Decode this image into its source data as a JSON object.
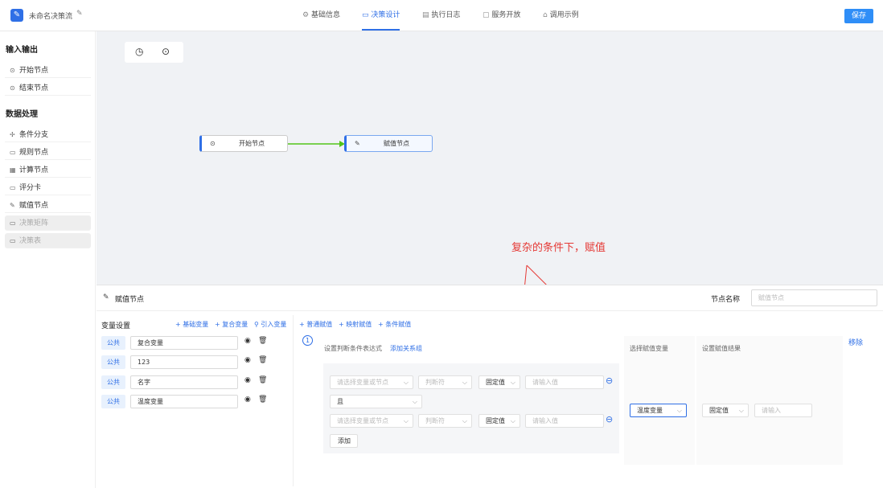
{
  "header": {
    "title": "未命名决策流",
    "tabs": [
      {
        "label": "基础信息"
      },
      {
        "label": "决策设计"
      },
      {
        "label": "执行日志"
      },
      {
        "label": "服务开放"
      },
      {
        "label": "调用示例"
      }
    ],
    "save_label": "保存"
  },
  "sidebar": {
    "sections": [
      {
        "title": "输入输出",
        "items": [
          {
            "label": "开始节点"
          },
          {
            "label": "结束节点"
          }
        ]
      },
      {
        "title": "数据处理",
        "items": [
          {
            "label": "条件分支"
          },
          {
            "label": "规则节点"
          },
          {
            "label": "计算节点"
          },
          {
            "label": "评分卡"
          },
          {
            "label": "赋值节点"
          },
          {
            "label": "决策矩阵"
          },
          {
            "label": "决策表"
          }
        ]
      }
    ]
  },
  "canvas": {
    "nodes": [
      {
        "label": "开始节点"
      },
      {
        "label": "赋值节点"
      }
    ],
    "annotation": "复杂的条件下，赋值"
  },
  "panel": {
    "title": "赋值节点",
    "node_name_label": "节点名称",
    "node_name_placeholder": "赋值节点",
    "var_settings": {
      "title": "变量设置",
      "actions": [
        "基础变量",
        "复合变量",
        "引入变量"
      ],
      "rows": [
        {
          "scope": "公共",
          "name": "复合变量"
        },
        {
          "scope": "公共",
          "name": "123"
        },
        {
          "scope": "公共",
          "name": "名字"
        },
        {
          "scope": "公共",
          "name": "温度变量"
        }
      ]
    },
    "assign": {
      "actions": [
        "普通赋值",
        "映射赋值",
        "条件赋值"
      ],
      "index": "1",
      "cond_label": "设置判断条件表达式",
      "add_group": "添加关系组",
      "var_placeholder": "请选择变量或节点",
      "op_placeholder": "判断符",
      "fixed_value": "固定值",
      "value_placeholder": "请输入值",
      "logic": "且",
      "add_label": "添加",
      "select_var_label": "选择赋值变量",
      "result_label": "设置赋值结果",
      "selected_var": "温度变量",
      "result_type": "固定值",
      "result_placeholder": "请输入",
      "remove_label": "移除"
    }
  },
  "colors": {
    "accent": "#2f6fe6",
    "annotation": "#e53935",
    "edge": "#52c41a"
  }
}
